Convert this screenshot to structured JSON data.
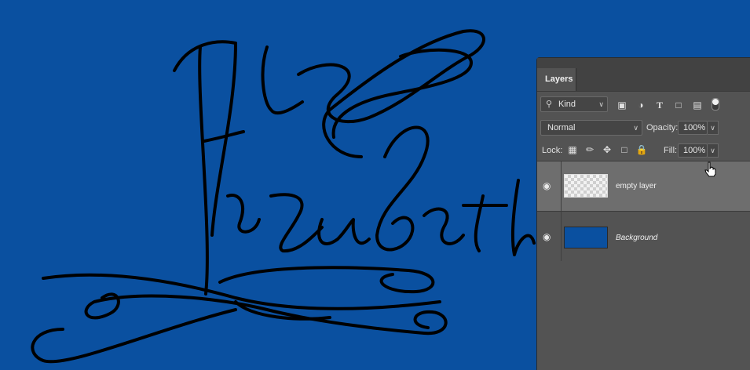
{
  "canvas": {
    "background_color": "#0a50a0",
    "ink_color": "#000000",
    "signature_text": "Elizabeth"
  },
  "layers_panel": {
    "tab_label": "Layers",
    "filter_kind": "Kind",
    "filter_icons": [
      "image-filter-icon",
      "adjustment-filter-icon",
      "type-filter-icon",
      "shape-filter-icon",
      "smart-object-filter-icon",
      "filter-toggle-icon"
    ],
    "blend_mode": "Normal",
    "opacity_label": "Opacity:",
    "opacity_value": "100%",
    "lock_label": "Lock:",
    "lock_icons": [
      "lock-transparent-pixels-icon",
      "lock-image-pixels-icon",
      "lock-position-icon",
      "lock-artboard-icon",
      "lock-all-icon"
    ],
    "fill_label": "Fill:",
    "fill_value": "100%",
    "layers": [
      {
        "name": "empty layer",
        "visible": true,
        "selected": true,
        "italic": false
      },
      {
        "name": "Background",
        "visible": true,
        "selected": false,
        "italic": true,
        "thumb_color": "#0a50a0"
      }
    ]
  }
}
